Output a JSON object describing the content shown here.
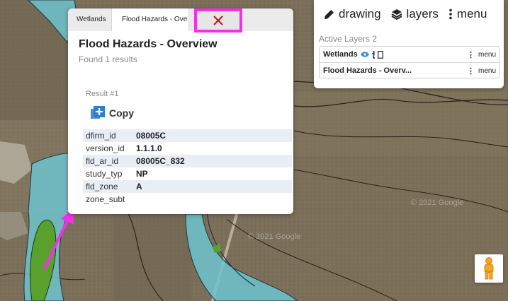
{
  "popup": {
    "tabs": [
      {
        "label": "Wetlands"
      },
      {
        "label": "Flood Hazards - Overview"
      }
    ],
    "close_icon": "close-icon",
    "title": "Flood Hazards - Overview",
    "subtitle": "Found 1 results",
    "result_label": "Result #1",
    "copy_label": "Copy",
    "attributes": [
      {
        "key": "dfirm_id",
        "value": "08005C"
      },
      {
        "key": "version_id",
        "value": "1.1.1.0"
      },
      {
        "key": "fld_ar_id",
        "value": "08005C_832"
      },
      {
        "key": "study_typ",
        "value": "NP"
      },
      {
        "key": "fld_zone",
        "value": "A"
      },
      {
        "key": "zone_subt",
        "value": ""
      }
    ]
  },
  "layers_panel": {
    "toolbar": {
      "drawing_label": "drawing",
      "layers_label": "layers",
      "menu_label": "menu"
    },
    "active_layers_label": "Active Layers 2",
    "layers": [
      {
        "name": "Wetlands",
        "menu_label": "menu"
      },
      {
        "name": "Flood Hazards - Overv...",
        "menu_label": "menu"
      }
    ]
  },
  "map": {
    "watermark_1": "© 2021 Google",
    "watermark_2": "© 2021 Google",
    "flood_zone_color": "#6fc3cf",
    "wetland_color": "#5aa02c",
    "annotation_color": "#f032e6"
  },
  "colors": {
    "highlight": "#f032e6",
    "row_stripe": "#e9eef6"
  }
}
